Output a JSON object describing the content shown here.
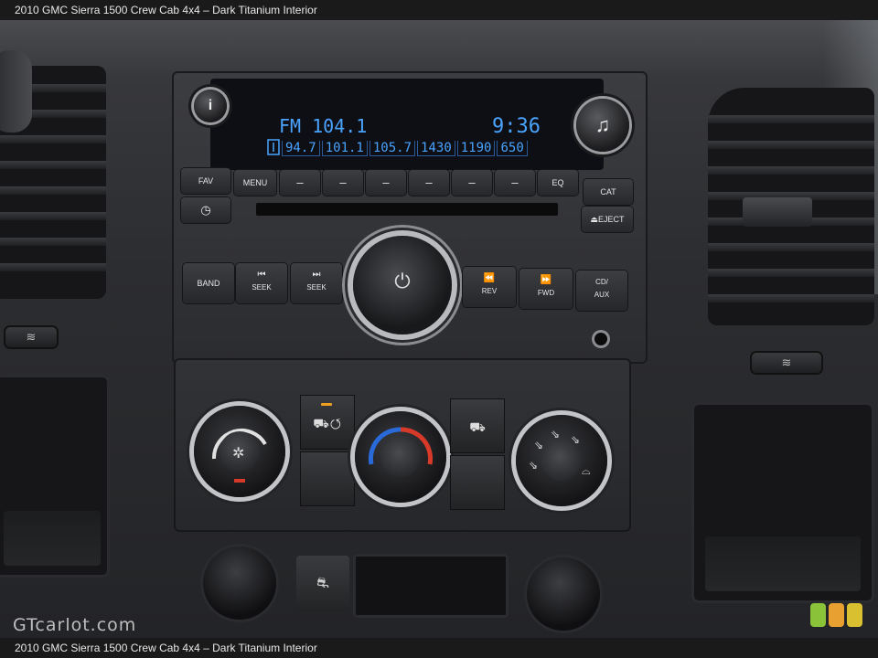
{
  "caption": {
    "top": "2010 GMC Sierra 1500 Crew Cab 4x4 – Dark Titanium Interior",
    "bottom": "2010 GMC Sierra 1500 Crew Cab 4x4 – Dark Titanium Interior"
  },
  "display": {
    "band_freq": "FM 104.1",
    "time": "9:36",
    "presets": [
      "94.7",
      "101.1",
      "105.7",
      "1430",
      "1190",
      "650"
    ]
  },
  "radio_buttons": {
    "fav": "FAV",
    "menu": "MENU",
    "eq": "EQ",
    "cat": "CAT",
    "eject": "⏏EJECT",
    "band": "BAND",
    "seek_back": "SEEK",
    "seek_fwd": "SEEK",
    "rev": "REV",
    "fwd": "FWD",
    "cd": "CD/",
    "aux": "AUX",
    "info": "i",
    "music": "♫",
    "clock": "◷",
    "power": "⏻"
  },
  "watermark": "GTcarlot.com",
  "colors": {
    "lcd_text": "#4aa3ff",
    "led_amber": "#f0a020",
    "temp_cold": "#2a6ad8",
    "temp_hot": "#d83a2a"
  }
}
